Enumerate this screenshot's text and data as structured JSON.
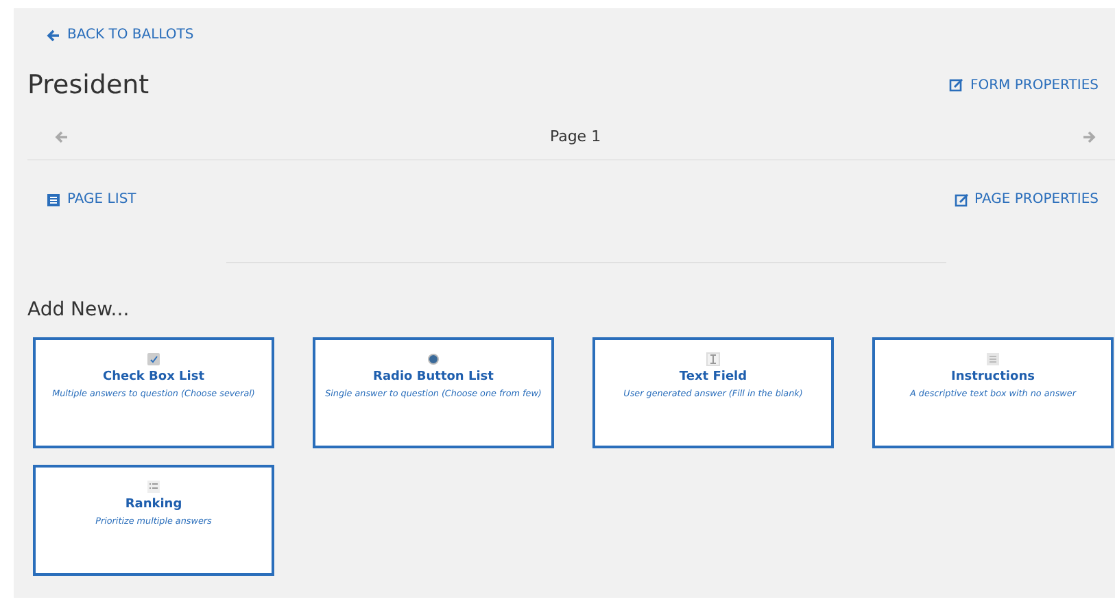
{
  "back_link": "BACK TO BALLOTS",
  "title": "President",
  "form_properties": "FORM PROPERTIES",
  "pager": {
    "label": "Page 1"
  },
  "page_list": "PAGE LIST",
  "page_properties": "PAGE PROPERTIES",
  "add_new": {
    "heading": "Add New...",
    "items": [
      {
        "kind": "checkbox",
        "title": "Check Box List",
        "description": "Multiple answers to question (Choose several)"
      },
      {
        "kind": "radio",
        "title": "Radio Button List",
        "description": "Single answer to question (Choose one from few)"
      },
      {
        "kind": "text",
        "title": "Text Field",
        "description": "User generated answer (Fill in the blank)"
      },
      {
        "kind": "instructions",
        "title": "Instructions",
        "description": "A descriptive text box with no answer"
      },
      {
        "kind": "ranking",
        "title": "Ranking",
        "description": "Prioritize multiple answers"
      }
    ]
  }
}
